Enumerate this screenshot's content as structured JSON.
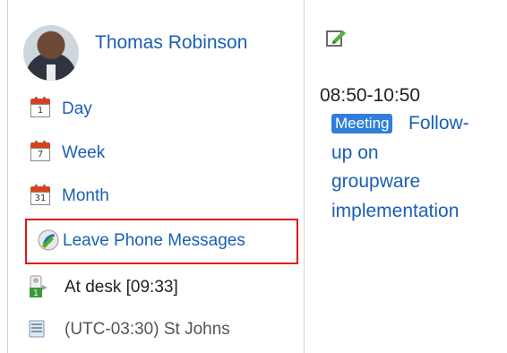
{
  "user": {
    "name": "Thomas Robinson"
  },
  "nav": {
    "day": {
      "label": "Day",
      "icon_number": "1"
    },
    "week": {
      "label": "Week",
      "icon_number": "7"
    },
    "month": {
      "label": "Month",
      "icon_number": "31"
    },
    "phone_messages": {
      "label": "Leave Phone Messages"
    }
  },
  "status": {
    "text": "At desk [09:33]"
  },
  "timezone": {
    "text": "(UTC-03:30) St Johns"
  },
  "schedule": {
    "time_range": "08:50-10:50",
    "event": {
      "badge": "Meeting",
      "title_lines": [
        "Follow-",
        "up on",
        "groupware",
        "implementation"
      ]
    }
  },
  "colors": {
    "link": "#1a5fb4",
    "badge_bg": "#2f7fda",
    "highlight_border": "#e0141c",
    "calendar_red": "#d9411e"
  },
  "icons": {
    "avatar": "user-avatar",
    "calendar": "calendar-icon",
    "phone": "phone-message-icon",
    "status": "presence-status-icon",
    "timezone": "timezone-icon",
    "edit": "edit-icon"
  }
}
